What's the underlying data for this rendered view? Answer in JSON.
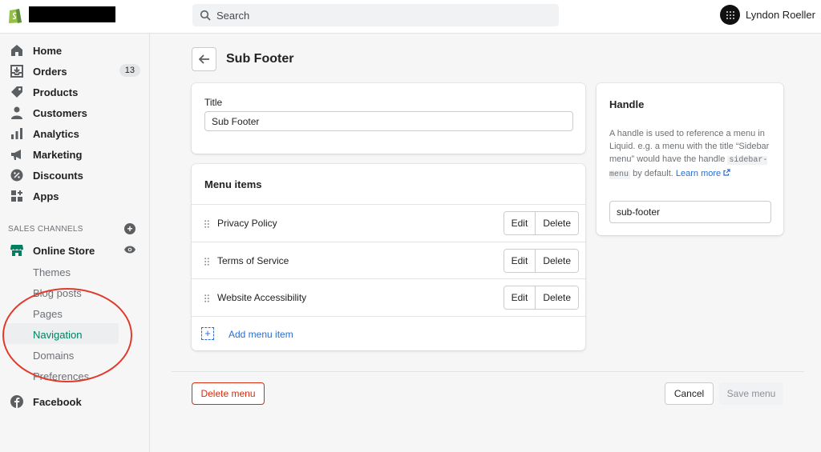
{
  "topbar": {
    "search_placeholder": "Search",
    "user_name": "Lyndon Roeller",
    "logo_icon": "shopify-bag-icon"
  },
  "sidebar": {
    "items": [
      {
        "label": "Home",
        "icon": "home-icon"
      },
      {
        "label": "Orders",
        "icon": "orders-icon",
        "badge": "13"
      },
      {
        "label": "Products",
        "icon": "tag-icon"
      },
      {
        "label": "Customers",
        "icon": "person-icon"
      },
      {
        "label": "Analytics",
        "icon": "bar-chart-icon"
      },
      {
        "label": "Marketing",
        "icon": "megaphone-icon"
      },
      {
        "label": "Discounts",
        "icon": "discount-icon"
      },
      {
        "label": "Apps",
        "icon": "apps-icon"
      }
    ],
    "sales_channels_heading": "SALES CHANNELS",
    "online_store": "Online Store",
    "online_store_sub": [
      "Themes",
      "Blog posts",
      "Pages",
      "Navigation",
      "Domains",
      "Preferences"
    ],
    "active_sub": "Navigation",
    "facebook": "Facebook"
  },
  "page": {
    "title": "Sub Footer"
  },
  "title_card": {
    "label": "Title",
    "value": "Sub Footer"
  },
  "menu_card": {
    "heading": "Menu items",
    "items": [
      {
        "name": "Privacy Policy",
        "edit": "Edit",
        "delete": "Delete"
      },
      {
        "name": "Terms of Service",
        "edit": "Edit",
        "delete": "Delete"
      },
      {
        "name": "Website Accessibility",
        "edit": "Edit",
        "delete": "Delete"
      }
    ],
    "add_label": "Add menu item"
  },
  "handle_card": {
    "heading": "Handle",
    "desc_1": "A handle is used to reference a menu in Liquid. e.g. a menu with the title “Sidebar menu” would have the handle",
    "desc_code": "sidebar-menu",
    "desc_2": "by default.",
    "learn_more": "Learn more",
    "value": "sub-footer"
  },
  "footer": {
    "delete_menu": "Delete menu",
    "cancel": "Cancel",
    "save": "Save menu"
  },
  "colors": {
    "accent_green": "#008060",
    "link_blue": "#2c6ecb",
    "critical_red": "#d72c0d",
    "annotation_circle": "#e03a2c"
  }
}
